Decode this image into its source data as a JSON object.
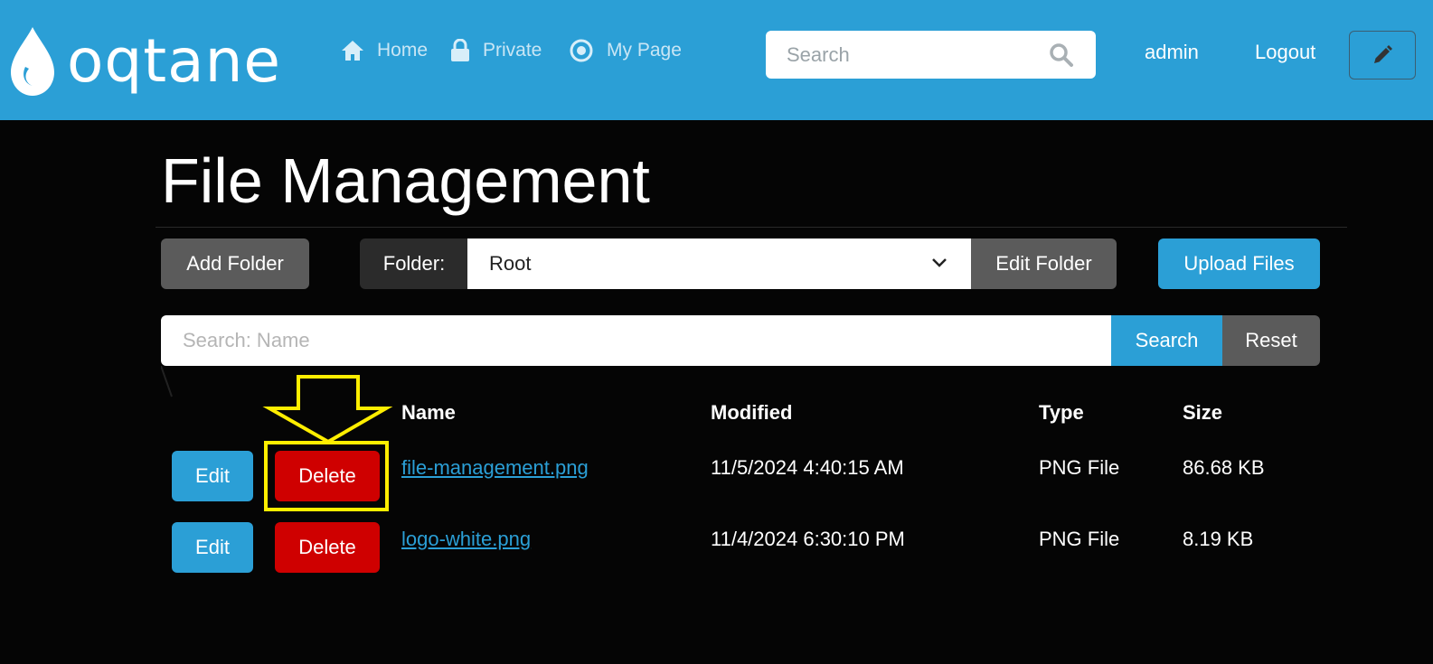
{
  "header": {
    "brand": "oqtane",
    "nav": [
      {
        "label": "Home",
        "icon": "home-icon"
      },
      {
        "label": "Private",
        "icon": "lock-icon"
      },
      {
        "label": "My Page",
        "icon": "target-icon"
      }
    ],
    "search_placeholder": "Search",
    "user": "admin",
    "logout": "Logout",
    "edit_icon": "pencil-icon",
    "colors": {
      "accent": "#2b9fd6"
    }
  },
  "main": {
    "title": "File Management",
    "toolbar": {
      "add_folder": "Add Folder",
      "folder_label": "Folder:",
      "folder_selected": "Root",
      "edit_folder": "Edit Folder",
      "upload_files": "Upload Files"
    },
    "filter": {
      "placeholder": "Search: Name",
      "search": "Search",
      "reset": "Reset"
    },
    "table": {
      "columns": [
        "Name",
        "Modified",
        "Type",
        "Size"
      ],
      "rows": [
        {
          "edit": "Edit",
          "delete": "Delete",
          "name": "file-management.png",
          "modified": "11/5/2024 4:40:15 AM",
          "type": "PNG File",
          "size": "86.68 KB"
        },
        {
          "edit": "Edit",
          "delete": "Delete",
          "name": "logo-white.png",
          "modified": "11/4/2024 6:30:10 PM",
          "type": "PNG File",
          "size": "8.19 KB"
        }
      ]
    },
    "colors": {
      "danger": "#cf0000",
      "secondary": "#5b5b5b",
      "highlight": "#ffee00"
    }
  }
}
